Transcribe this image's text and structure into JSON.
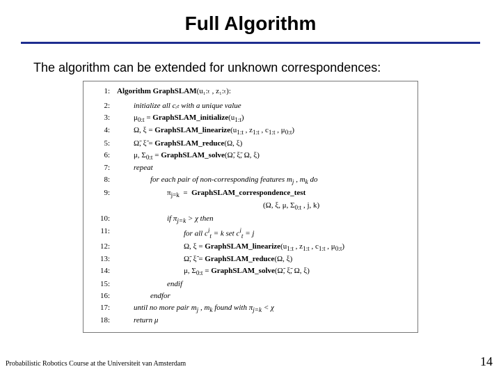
{
  "title": "Full Algorithm",
  "subtitle": "The algorithm can be extended for unknown correspondences:",
  "algo": {
    "header_label": "Algorithm GraphSLAM",
    "header_args": "(u₁:ₜ , z₁:ₜ):",
    "lines": {
      "n1": "1:",
      "n2": "2:",
      "l2": "initialize all cᵢₜ with a unique value",
      "n3": "3:",
      "l3": "μ₀:ₜ = GraphSLAM_initialize(u₁:ₜ)",
      "n4": "4:",
      "l4": "Ω, ξ = GraphSLAM_linearize(u₁:ₜ , z₁:ₜ , c₁:ₜ , μ₀:ₜ)",
      "n5": "5:",
      "l5": "Ω̃, ξ̃ = GraphSLAM_reduce(Ω, ξ)",
      "n6": "6:",
      "l6": "μ, Σ₀:ₜ = GraphSLAM_solve(Ω̃, ξ̃, Ω, ξ)",
      "n7": "7:",
      "l7": "repeat",
      "n8": "8:",
      "l8": "for each pair of non-corresponding features mⱼ , mₖ do",
      "n9": "9:",
      "l9a": "πⱼ₌ₖ = ",
      "l9b": "GraphSLAM_correspondence_test",
      "n9ex": "(Ω, ξ, μ, Σ₀:ₜ , j, k)",
      "n10": "10:",
      "l10": "if πⱼ₌ₖ > χ then",
      "n11": "11:",
      "l11": "for all cᵢₜ = k set cᵢₜ = j",
      "n12": "12:",
      "l12": "Ω, ξ = GraphSLAM_linearize(u₁:ₜ , z₁:ₜ , c₁:ₜ , μ₀:ₜ)",
      "n13": "13:",
      "l13": "Ω̃, ξ̃ = GraphSLAM_reduce(Ω, ξ)",
      "n14": "14:",
      "l14": "μ, Σ₀:ₜ = GraphSLAM_solve(Ω̃, ξ̃, Ω, ξ)",
      "n15": "15:",
      "l15": "endif",
      "n16": "16:",
      "l16": "endfor",
      "n17": "17:",
      "l17": "until no more pair mⱼ , mₖ found with πⱼ₌ₖ < χ",
      "n18": "18:",
      "l18": "return μ"
    }
  },
  "footer_left": "Probabilistic Robotics Course at the Universiteit van Amsterdam",
  "footer_right": "14"
}
